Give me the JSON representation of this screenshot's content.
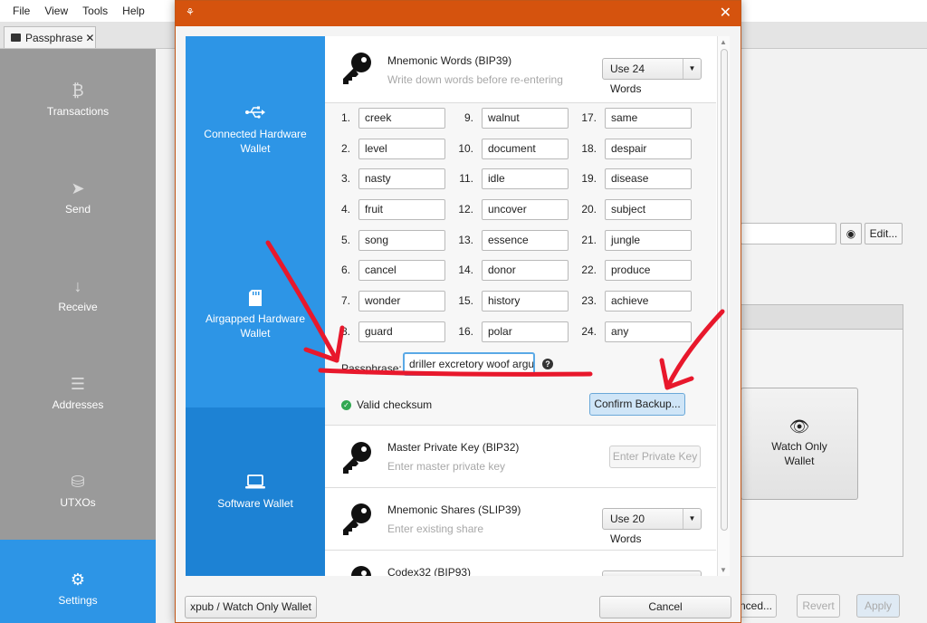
{
  "menu": [
    "File",
    "View",
    "Tools",
    "Help"
  ],
  "app_tab": {
    "label": "Passphrase",
    "close": "✕"
  },
  "sidebar": [
    {
      "label": "Transactions",
      "icon": "bitcoin-icon"
    },
    {
      "label": "Send",
      "icon": "send-icon"
    },
    {
      "label": "Receive",
      "icon": "receive-icon"
    },
    {
      "label": "Addresses",
      "icon": "list-icon"
    },
    {
      "label": "UTXOs",
      "icon": "coins-icon"
    },
    {
      "label": "Settings",
      "icon": "gear-icon"
    }
  ],
  "background": {
    "edit_label": "Edit...",
    "watch_only_label": "Watch Only Wallet",
    "advanced_label": "nced...",
    "revert_label": "Revert",
    "apply_label": "Apply"
  },
  "dialog": {
    "close": "✕",
    "nav": [
      {
        "label": "Connected Hardware Wallet",
        "icon": "usb-icon"
      },
      {
        "label": "Airgapped Hardware Wallet",
        "icon": "sdcard-icon"
      },
      {
        "label": "Software Wallet",
        "icon": "laptop-icon"
      }
    ],
    "bip39": {
      "title": "Mnemonic Words (BIP39)",
      "subtitle": "Write down words before re-entering",
      "words_button": "Use 24 Words",
      "words": [
        "creek",
        "level",
        "nasty",
        "fruit",
        "song",
        "cancel",
        "wonder",
        "guard",
        "walnut",
        "document",
        "idle",
        "uncover",
        "essence",
        "donor",
        "history",
        "polar",
        "same",
        "despair",
        "disease",
        "subject",
        "jungle",
        "produce",
        "achieve",
        "any"
      ],
      "passphrase_label": "Passphrase:",
      "passphrase_value": "driller excretory woof argu",
      "checksum_text": "Valid checksum",
      "confirm_button": "Confirm Backup..."
    },
    "bip32": {
      "title": "Master Private Key (BIP32)",
      "subtitle": "Enter master private key",
      "button": "Enter Private Key"
    },
    "slip39": {
      "title": "Mnemonic Shares (SLIP39)",
      "subtitle": "Enter existing share",
      "button": "Use 20 Words"
    },
    "codex": {
      "title": "Codex32 (BIP93)"
    },
    "xpub_button": "xpub / Watch Only Wallet",
    "cancel_button": "Cancel"
  },
  "colors": {
    "title_bar": "#d5530e",
    "nav_blue": "#2d95e6",
    "annotation_red": "#e8182c"
  }
}
